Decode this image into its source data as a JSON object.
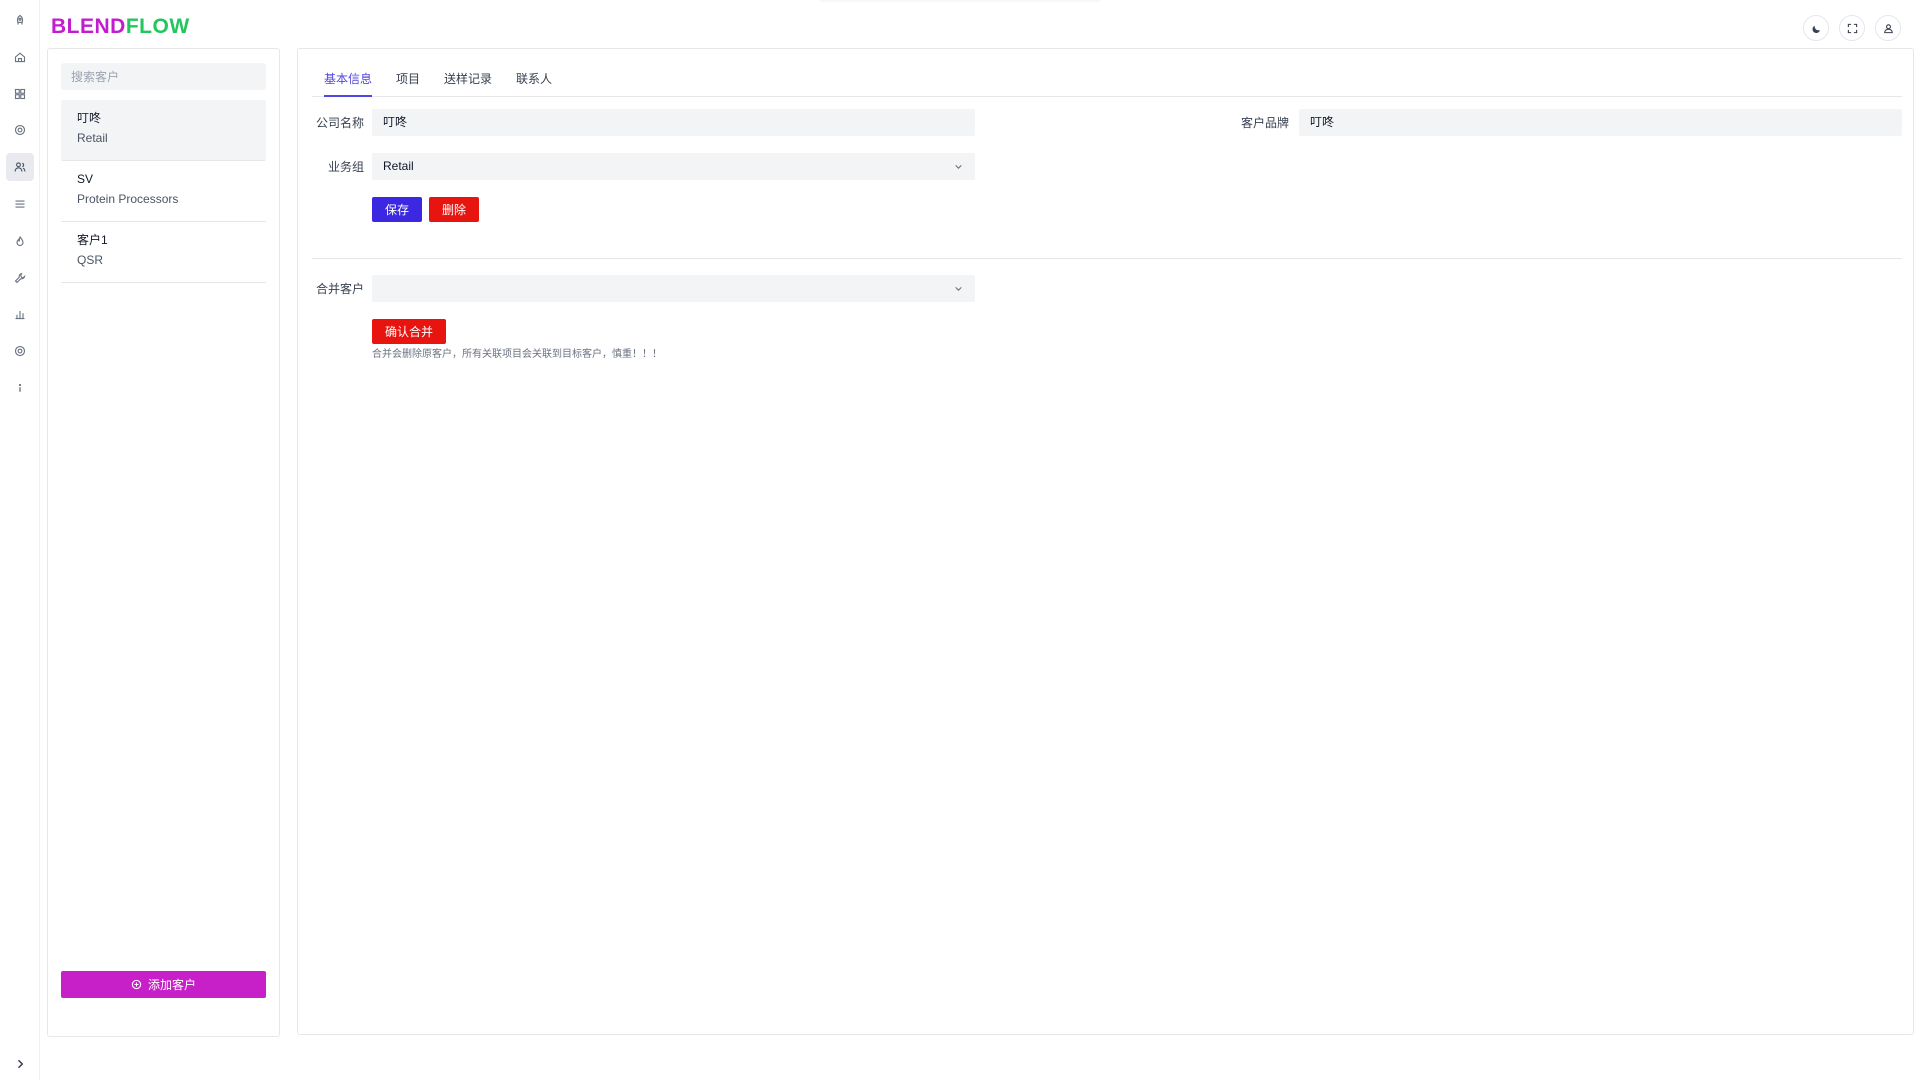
{
  "app": {
    "logo_part1": "BLEND",
    "logo_part2": "FLOW"
  },
  "rail": {
    "items": [
      {
        "name": "rocket-icon"
      },
      {
        "name": "home-icon"
      },
      {
        "name": "grid-icon"
      },
      {
        "name": "target-icon"
      },
      {
        "name": "customers-icon"
      },
      {
        "name": "list-icon"
      },
      {
        "name": "fire-icon"
      },
      {
        "name": "wrench-icon"
      },
      {
        "name": "bar-chart-icon"
      },
      {
        "name": "settings-icon"
      },
      {
        "name": "info-icon"
      }
    ],
    "active_index": 4
  },
  "header": {
    "buttons": [
      "theme-toggle-button",
      "fullscreen-button",
      "user-button"
    ]
  },
  "customer_list": {
    "search_placeholder": "搜索客户",
    "items": [
      {
        "name": "叮咚",
        "group": "Retail",
        "selected": true
      },
      {
        "name": "SV",
        "group": "Protein Processors",
        "selected": false
      },
      {
        "name": "客户1",
        "group": "QSR",
        "selected": false
      }
    ],
    "add_label": "添加客户"
  },
  "detail": {
    "tabs": [
      {
        "label": "基本信息",
        "active": true
      },
      {
        "label": "项目",
        "active": false
      },
      {
        "label": "送样记录",
        "active": false
      },
      {
        "label": "联系人",
        "active": false
      }
    ],
    "company_name_label": "公司名称",
    "company_name_value": "叮咚",
    "brand_label": "客户品牌",
    "brand_value": "叮咚",
    "group_label": "业务组",
    "group_value": "Retail",
    "save_label": "保存",
    "delete_label": "删除",
    "merge_label": "合并客户",
    "merge_value": "",
    "confirm_merge_label": "确认合并",
    "merge_warning": "合并会删除原客户，所有关联项目会关联到目标客户，慎重！！！"
  },
  "colors": {
    "accent": "#4f46e5",
    "brand_magenta": "#c820c8",
    "brand_green": "#22c55e",
    "danger": "#e8140f",
    "primary_button": "#3b28e0"
  }
}
